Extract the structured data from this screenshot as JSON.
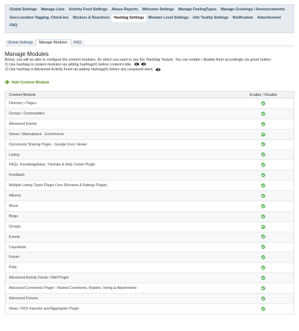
{
  "main_tabs": [
    {
      "label": "Global Settings",
      "active": false
    },
    {
      "label": "Manage Lists",
      "active": false
    },
    {
      "label": "Activity Feed Settings",
      "active": false
    },
    {
      "label": "Abuse Reports",
      "active": false
    },
    {
      "label": "Welcome Settings",
      "active": false
    },
    {
      "label": "Manage FeelingTypes",
      "active": false
    },
    {
      "label": "Manage Greetings / Announcements",
      "active": false
    },
    {
      "label": "Geo-Location Tagging, Check-Ins",
      "active": false
    },
    {
      "label": "Stickers & Reactions",
      "active": false
    },
    {
      "label": "Hashtag Settings",
      "active": true
    },
    {
      "label": "Member Level Settings",
      "active": false
    },
    {
      "label": "Info Tooltip Settings",
      "active": false
    },
    {
      "label": "Notification",
      "active": false
    },
    {
      "label": "Advertisment",
      "active": false
    },
    {
      "label": "FAQ",
      "active": false
    }
  ],
  "sub_tabs": [
    {
      "label": "Global Settings",
      "active": false
    },
    {
      "label": "Manage Modules",
      "active": true
    },
    {
      "label": "FAQ",
      "active": false
    }
  ],
  "page": {
    "title": "Manage Modules",
    "desc_intro": "Below, you will be able to configure the content modules, for which you want to use the 'Hashtag' feature. You can enable / disable them accordingly via green button.",
    "desc_line1": "1) Use hashtag in content modules via adding hashtag(#) before content's title.",
    "desc_line2": "2) Use hashtag in Advanced Activity Feed via adding hashtag(#) before any unspaced word.",
    "add_label": "Add Content Module"
  },
  "table": {
    "col_module": "Content Module",
    "col_status": "Enable / Disable",
    "rows": [
      {
        "name": "Directory / Pages",
        "enabled": true
      },
      {
        "name": "Groups / Communities",
        "enabled": true
      },
      {
        "name": "Advanced Events",
        "enabled": true
      },
      {
        "name": "Stores / Marketplace - Ecommerce",
        "enabled": true
      },
      {
        "name": "Documents Sharing Plugin - Google Docs Viewer",
        "enabled": true
      },
      {
        "name": "Listing",
        "enabled": true
      },
      {
        "name": "FAQs, Knowledgebase, Tutorials & Help Center Plugin",
        "enabled": true
      },
      {
        "name": "Feedback",
        "enabled": true
      },
      {
        "name": "Multiple Listing Types Plugin Core (Reviews & Ratings Plugin)",
        "enabled": true
      },
      {
        "name": "Albums",
        "enabled": true
      },
      {
        "name": "Music",
        "enabled": true
      },
      {
        "name": "Blogs",
        "enabled": true
      },
      {
        "name": "Groups",
        "enabled": true
      },
      {
        "name": "Events",
        "enabled": true
      },
      {
        "name": "Classifieds",
        "enabled": true
      },
      {
        "name": "Forum",
        "enabled": true
      },
      {
        "name": "Polls",
        "enabled": true
      },
      {
        "name": "Advanced Activity Feeds / Wall Plugin",
        "enabled": true
      },
      {
        "name": "Advanced Comments Plugin - Nested Comments, Replies, Voting & Attachments",
        "enabled": true
      },
      {
        "name": "Advanced Forums",
        "enabled": true
      },
      {
        "name": "News / RSS Importer and Aggregator Plugin",
        "enabled": true
      }
    ]
  },
  "colors": {
    "accent_green": "#5cb85c",
    "tab_bar": "#e6ebf0",
    "link_green": "#5a8a1e"
  },
  "icons": {
    "eye": "eye-icon",
    "add": "plus-icon",
    "status": "check-circle-icon"
  }
}
